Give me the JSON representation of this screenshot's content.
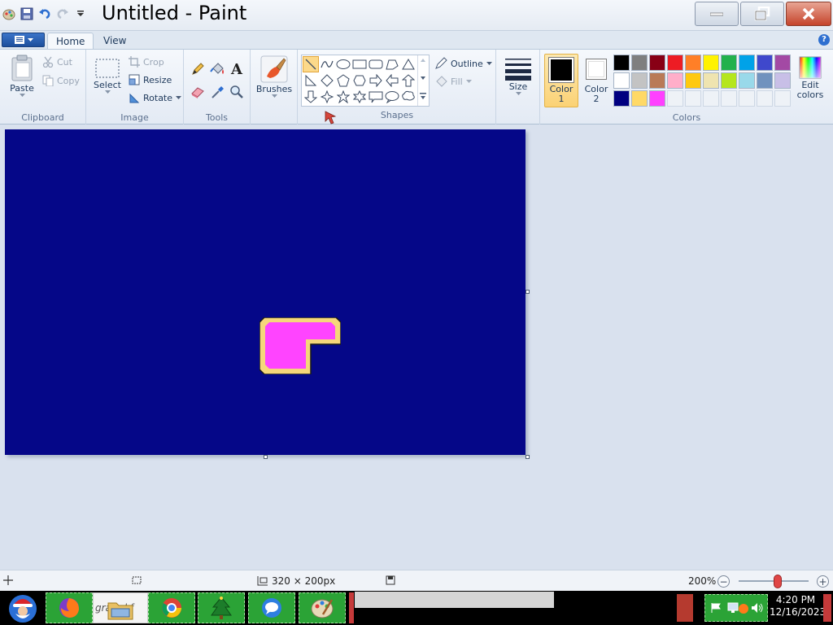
{
  "window": {
    "title": "Untitled - Paint"
  },
  "tabs": {
    "home": "Home",
    "view": "View"
  },
  "clipboard": {
    "paste": "Paste",
    "cut": "Cut",
    "copy": "Copy",
    "group": "Clipboard"
  },
  "image": {
    "select": "Select",
    "crop": "Crop",
    "resize": "Resize",
    "rotate": "Rotate",
    "group": "Image"
  },
  "tools": {
    "group": "Tools",
    "text_tool": "A"
  },
  "brushes": {
    "label": "Brushes"
  },
  "shapes": {
    "outline": "Outline",
    "fill": "Fill",
    "group": "Shapes"
  },
  "size": {
    "label": "Size"
  },
  "colors": {
    "color1_label": "Color",
    "color1_num": "1",
    "color2_label": "Color",
    "color2_num": "2",
    "edit_label": "Edit",
    "edit_label2": "colors",
    "group": "Colors",
    "color1_value": "#000000",
    "color2_value": "#ffffff",
    "palette_row1": [
      "#000000",
      "#7f7f7f",
      "#880015",
      "#ed1c24",
      "#ff7f27",
      "#fff200",
      "#22b14c",
      "#00a2e8",
      "#3f48cc",
      "#a349a4"
    ],
    "palette_row2": [
      "#ffffff",
      "#c3c3c3",
      "#b97a57",
      "#ffaec9",
      "#ffc90e",
      "#efe4b0",
      "#b5e61d",
      "#99d9ea",
      "#7092be",
      "#c8bfe7"
    ],
    "palette_row3": [
      "#000080",
      "#ffd966",
      "#ff40ff"
    ]
  },
  "canvas": {
    "background": "#050788",
    "shape_fill": "#ff44ff",
    "shape_outline": "#f5d77a"
  },
  "status": {
    "dimensions": "320 × 200px",
    "zoom": "200%"
  },
  "taskbar": {
    "partial_text": "gra...d f",
    "time": "4:20 PM",
    "date": "12/16/2023"
  }
}
